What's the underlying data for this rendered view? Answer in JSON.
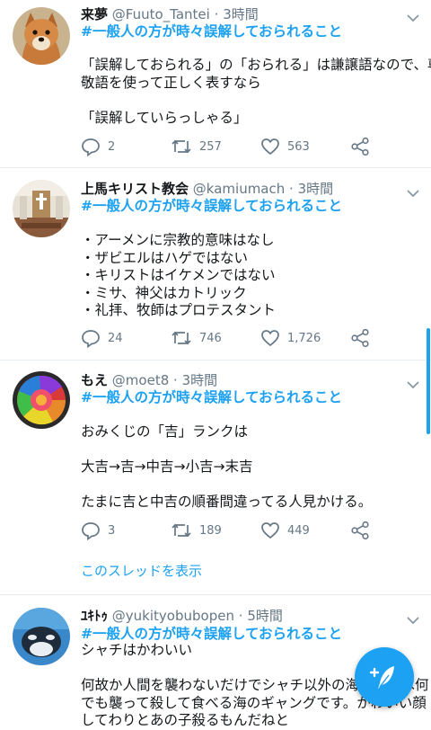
{
  "tweets": [
    {
      "name": "来夢",
      "handle": "@Fuuto_Tantei",
      "dot": "·",
      "time": "3時間",
      "hashtag": "#一般人の方が時々誤解しておられること",
      "lines": [
        "「誤解しておられる」の「おられる」は謙譲語なので、尊",
        "敬語を使って正しく表すなら",
        "",
        "「誤解していらっしゃる」"
      ],
      "replies": "2",
      "retweets": "257",
      "likes": "563",
      "avatar_icon": "shiba-dog-avatar"
    },
    {
      "name": "上馬キリスト教会",
      "handle": "@kamiumach",
      "dot": "·",
      "time": "3時間",
      "hashtag": "#一般人の方が時々誤解しておられること",
      "lines": [
        "・アーメンに宗教的意味はなし",
        "・ザビエルはハゲではない",
        "・キリストはイケメンではない",
        "・ミサ、神父はカトリック",
        "・礼拝、牧師はプロテスタント"
      ],
      "replies": "24",
      "retweets": "746",
      "likes": "1,726",
      "avatar_icon": "church-interior-avatar"
    },
    {
      "name": "もえ",
      "handle": "@moet8",
      "dot": "·",
      "time": "3時間",
      "hashtag": "#一般人の方が時々誤解しておられること",
      "lines": [
        "おみくじの「吉」ランクは",
        "",
        "大吉→吉→中吉→小吉→末吉",
        "",
        "たまに吉と中吉の順番間違ってる人見かける。"
      ],
      "replies": "3",
      "retweets": "189",
      "likes": "449",
      "thread_link": "このスレッドを表示",
      "avatar_icon": "rainbow-rose-avatar"
    },
    {
      "name": "ﾕｷﾄｩ",
      "handle": "@yukityobubopen",
      "dot": "·",
      "time": "5時間",
      "hashtag": "#一般人の方が時々誤解しておられること",
      "lines": [
        "シャチはかわいい",
        "",
        "何故か人間を襲わないだけでシャチ以外の海洋生物は何",
        "でも襲って殺して食べる海のギャングです。かわいい顔",
        "してわりとあの子殺るもんだねと"
      ],
      "avatar_icon": "orca-avatar"
    }
  ],
  "colors": {
    "accent": "#1da1f2",
    "secondary_text": "#657786",
    "divider": "#e6ecf0"
  }
}
